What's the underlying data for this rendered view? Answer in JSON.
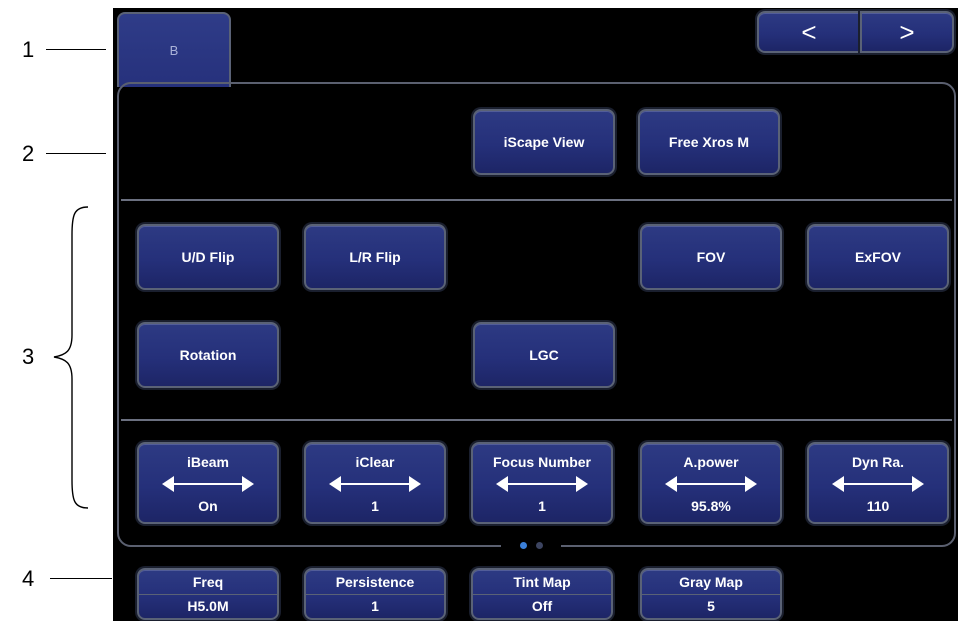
{
  "callouts": [
    "1",
    "2",
    "3",
    "4"
  ],
  "tab": {
    "label": "B"
  },
  "pager": {
    "prev_icon": "chevron-left-icon",
    "next_icon": "chevron-right-icon",
    "prev": "<",
    "next": ">"
  },
  "row1": {
    "iscape_view": "iScape View",
    "free_xros_m": "Free Xros M"
  },
  "row2": {
    "ud_flip": "U/D Flip",
    "lr_flip": "L/R Flip",
    "fov": "FOV",
    "exfov": "ExFOV"
  },
  "row3": {
    "rotation": "Rotation",
    "lgc": "LGC"
  },
  "controls": [
    {
      "label": "iBeam",
      "value": "On"
    },
    {
      "label": "iClear",
      "value": "1"
    },
    {
      "label": "Focus Number",
      "value": "1"
    },
    {
      "label": "A.power",
      "value": "95.8%"
    },
    {
      "label": "Dyn Ra.",
      "value": "110"
    }
  ],
  "page_indicator": {
    "total": 2,
    "current": 1,
    "active_color": "#3a7fd8",
    "inactive_color": "#3c4460"
  },
  "params": [
    {
      "label": "Freq",
      "value": "H5.0M"
    },
    {
      "label": "Persistence",
      "value": "1"
    },
    {
      "label": "Tint Map",
      "value": "Off"
    },
    {
      "label": "Gray Map",
      "value": "5"
    }
  ],
  "colors": {
    "button": "#26317c",
    "border": "#5a6276",
    "screen": "#000000"
  }
}
